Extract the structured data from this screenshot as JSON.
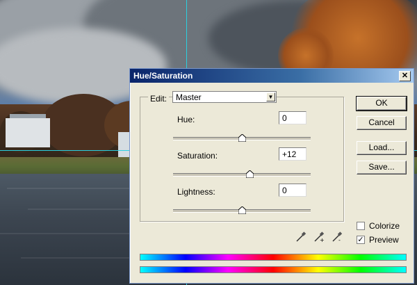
{
  "dialog": {
    "title": "Hue/Saturation",
    "close_label": "✕",
    "edit_label": "Edit:",
    "edit_value": "Master",
    "params": [
      {
        "key": "hue",
        "label": "Hue:",
        "value": "0",
        "slider_fraction": 0.5
      },
      {
        "key": "saturation",
        "label": "Saturation:",
        "value": "+12",
        "slider_fraction": 0.56
      },
      {
        "key": "lightness",
        "label": "Lightness:",
        "value": "0",
        "slider_fraction": 0.5
      }
    ],
    "buttons": {
      "ok": "OK",
      "cancel": "Cancel",
      "load": "Load...",
      "save": "Save..."
    },
    "colorize_label": "Colorize",
    "colorize_checked": false,
    "preview_label": "Preview",
    "preview_checked": true,
    "eyedroppers": [
      "eyedropper-icon",
      "eyedropper-plus-icon",
      "eyedropper-minus-icon"
    ]
  },
  "colors": {
    "titlebar_start": "#0a246a",
    "titlebar_end": "#a6caf0",
    "guide": "#2ad0e0"
  }
}
